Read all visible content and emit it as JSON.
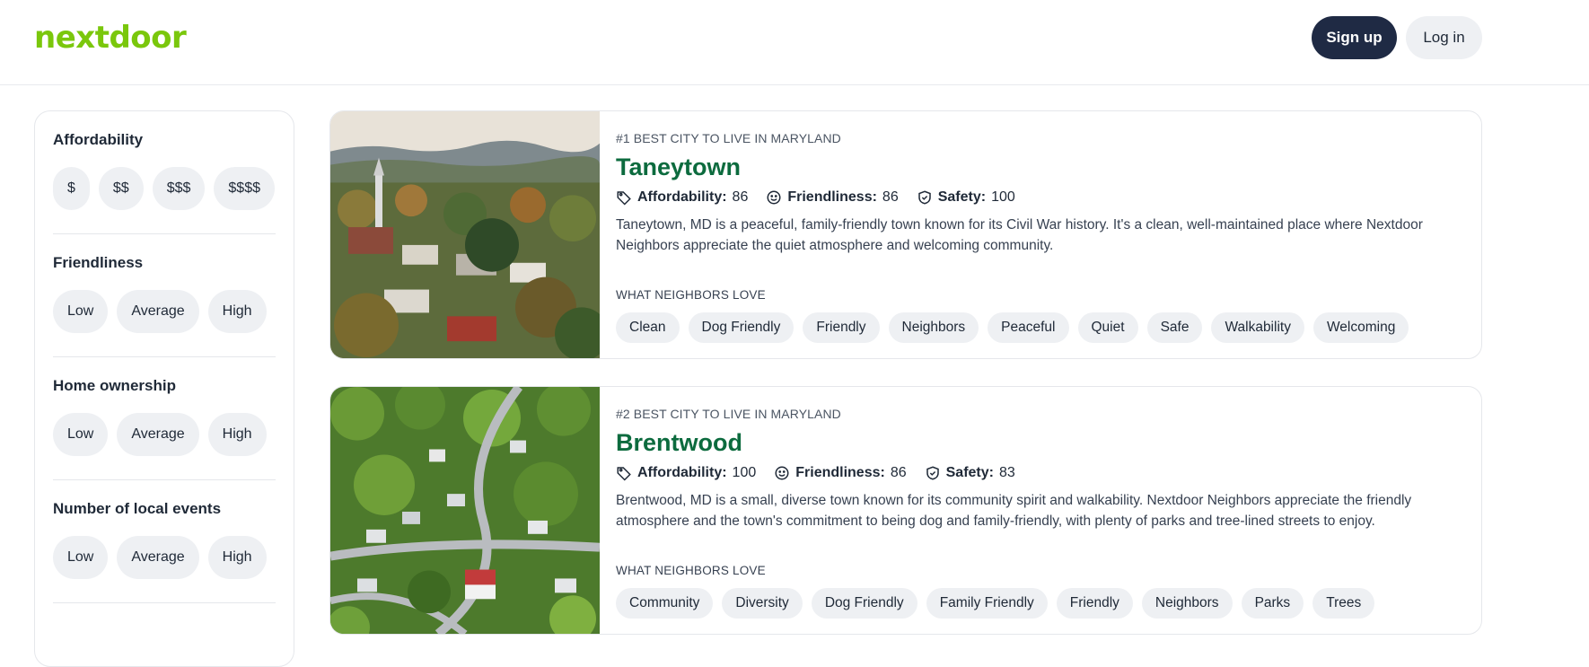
{
  "header": {
    "logo": "nextdoor",
    "signup_label": "Sign up",
    "login_label": "Log in"
  },
  "filters": [
    {
      "title": "Affordability",
      "options": [
        "$",
        "$$",
        "$$$",
        "$$$$"
      ]
    },
    {
      "title": "Friendliness",
      "options": [
        "Low",
        "Average",
        "High"
      ]
    },
    {
      "title": "Home ownership",
      "options": [
        "Low",
        "Average",
        "High"
      ]
    },
    {
      "title": "Number of local events",
      "options": [
        "Low",
        "Average",
        "High"
      ]
    }
  ],
  "cities": [
    {
      "rank": "#1 BEST CITY TO LIVE IN MARYLAND",
      "name": "Taneytown",
      "affordability_label": "Affordability:",
      "affordability": "86",
      "friendliness_label": "Friendliness:",
      "friendliness": "86",
      "safety_label": "Safety:",
      "safety": "100",
      "description": "Taneytown, MD is a peaceful, family-friendly town known for its Civil War history. It's a clean, well-maintained place where Nextdoor Neighbors appreciate the quiet atmosphere and welcoming community.",
      "love_title": "WHAT NEIGHBORS LOVE",
      "tags": [
        "Clean",
        "Dog Friendly",
        "Friendly",
        "Neighbors",
        "Peaceful",
        "Quiet",
        "Safe",
        "Walkability",
        "Welcoming"
      ]
    },
    {
      "rank": "#2 BEST CITY TO LIVE IN MARYLAND",
      "name": "Brentwood",
      "affordability_label": "Affordability:",
      "affordability": "100",
      "friendliness_label": "Friendliness:",
      "friendliness": "86",
      "safety_label": "Safety:",
      "safety": "83",
      "description": "Brentwood, MD is a small, diverse town known for its community spirit and walkability. Nextdoor Neighbors appreciate the friendly atmosphere and the town's commitment to being dog and family-friendly, with plenty of parks and tree-lined streets to enjoy.",
      "love_title": "WHAT NEIGHBORS LOVE",
      "tags": [
        "Community",
        "Diversity",
        "Dog Friendly",
        "Family Friendly",
        "Friendly",
        "Neighbors",
        "Parks",
        "Trees"
      ]
    }
  ],
  "colors": {
    "brand": "#7ac70c",
    "city_name": "#0c6b3e",
    "primary_button": "#1f2a44",
    "chip_bg": "#eef0f3"
  },
  "icons": [
    "tag-icon",
    "smiley-icon",
    "shield-check-icon"
  ]
}
